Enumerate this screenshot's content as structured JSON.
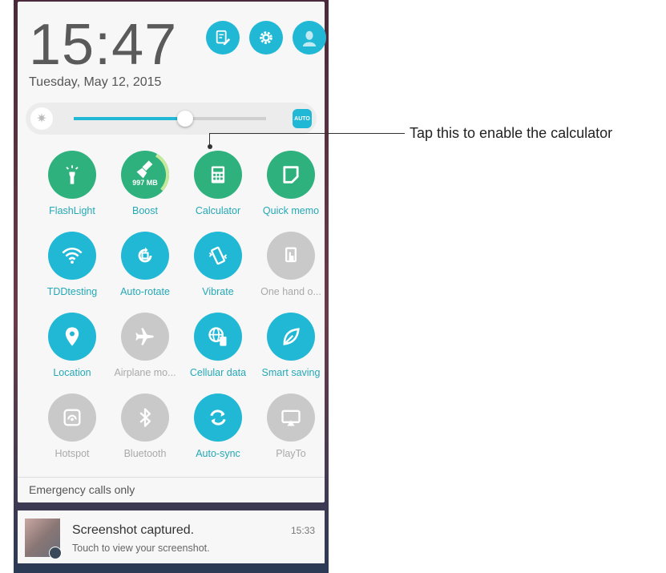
{
  "status": {
    "time": "15:47",
    "date": "Tuesday, May 12, 2015"
  },
  "header_buttons": [
    {
      "name": "edit-settings",
      "icon": "edit-icon"
    },
    {
      "name": "settings",
      "icon": "gear-icon"
    },
    {
      "name": "profile",
      "icon": "avatar-icon"
    }
  ],
  "brightness": {
    "level": 0.58,
    "auto_label": "AUTO"
  },
  "tiles": [
    {
      "label": "FlashLight",
      "icon": "flashlight-icon",
      "state": "on-green"
    },
    {
      "label": "Boost",
      "icon": "broom-icon",
      "value": "997 MB",
      "state": "on-green"
    },
    {
      "label": "Calculator",
      "icon": "calculator-icon",
      "state": "on-green"
    },
    {
      "label": "Quick memo",
      "icon": "memo-icon",
      "state": "on-green"
    },
    {
      "label": "TDDtesting",
      "icon": "wifi-icon",
      "state": "on"
    },
    {
      "label": "Auto-rotate",
      "icon": "rotate-icon",
      "state": "on"
    },
    {
      "label": "Vibrate",
      "icon": "vibrate-icon",
      "state": "on"
    },
    {
      "label": "One hand o...",
      "icon": "one-hand-icon",
      "state": "off"
    },
    {
      "label": "Location",
      "icon": "location-icon",
      "state": "on"
    },
    {
      "label": "Airplane mo...",
      "icon": "airplane-icon",
      "state": "off"
    },
    {
      "label": "Cellular data",
      "icon": "cellular-data-icon",
      "state": "on"
    },
    {
      "label": "Smart saving",
      "icon": "leaf-icon",
      "state": "on"
    },
    {
      "label": "Hotspot",
      "icon": "hotspot-icon",
      "state": "off"
    },
    {
      "label": "Bluetooth",
      "icon": "bluetooth-icon",
      "state": "off"
    },
    {
      "label": "Auto-sync",
      "icon": "sync-icon",
      "state": "on"
    },
    {
      "label": "PlayTo",
      "icon": "playto-icon",
      "state": "off"
    }
  ],
  "emergency_text": "Emergency calls only",
  "notification": {
    "title": "Screenshot captured.",
    "subtitle": "Touch to view your screenshot.",
    "time": "15:33"
  },
  "callout": {
    "text": "Tap this to enable the calculator"
  },
  "colors": {
    "accent": "#21b8d6",
    "green": "#2eb17d",
    "off": "#c9c9c9"
  }
}
